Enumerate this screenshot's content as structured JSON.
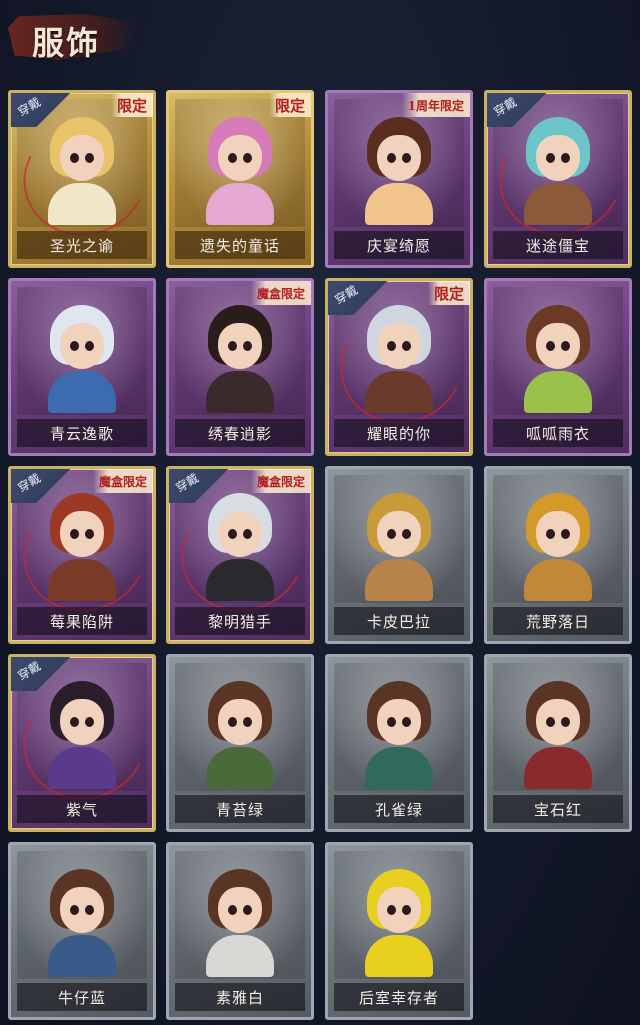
{
  "header": {
    "title": "服饰"
  },
  "worn_label": "穿戴",
  "cards": [
    {
      "name": "圣光之谕",
      "rarity": "gold",
      "tag": "限定",
      "worn": true,
      "hair": "#e9c36a",
      "body": "#f2e6c8"
    },
    {
      "name": "遗失的童话",
      "rarity": "gold",
      "tag": "限定",
      "worn": false,
      "hair": "#d77ab8",
      "body": "#e4a8d2"
    },
    {
      "name": "庆宴绮愿",
      "rarity": "purple",
      "tag": "1周年限定",
      "worn": false,
      "hair": "#5a2e1f",
      "body": "#f0c48a"
    },
    {
      "name": "迷途僵宝",
      "rarity": "purple",
      "tag": "",
      "worn": true,
      "hair": "#6cc6c8",
      "body": "#8a5a3a"
    },
    {
      "name": "青云逸歌",
      "rarity": "purple",
      "tag": "",
      "worn": false,
      "hair": "#dfe6ef",
      "body": "#3c6bb0"
    },
    {
      "name": "绣春逍影",
      "rarity": "purple",
      "tag": "魔盒限定",
      "worn": false,
      "hair": "#2a1c18",
      "body": "#3a2a2a"
    },
    {
      "name": "耀眼的你",
      "rarity": "purple",
      "tag": "限定",
      "worn": true,
      "hair": "#cfd6e0",
      "body": "#6a3a2a"
    },
    {
      "name": "呱呱雨衣",
      "rarity": "purple",
      "tag": "",
      "worn": false,
      "hair": "#6b3a24",
      "body": "#9ac24a"
    },
    {
      "name": "莓果陷阱",
      "rarity": "purple",
      "tag": "魔盒限定",
      "worn": true,
      "hair": "#9a3a24",
      "body": "#7a3a28"
    },
    {
      "name": "黎明猎手",
      "rarity": "purple",
      "tag": "魔盒限定",
      "worn": true,
      "hair": "#d8dde4",
      "body": "#2a2a30"
    },
    {
      "name": "卡皮巴拉",
      "rarity": "grey",
      "tag": "",
      "worn": false,
      "hair": "#c99a3a",
      "body": "#b8834a"
    },
    {
      "name": "荒野落日",
      "rarity": "grey",
      "tag": "",
      "worn": false,
      "hair": "#d39a2a",
      "body": "#c08838"
    },
    {
      "name": "紫气",
      "rarity": "purple",
      "tag": "",
      "worn": true,
      "hair": "#2a1e2a",
      "body": "#5a3a8a"
    },
    {
      "name": "青苔绿",
      "rarity": "grey",
      "tag": "",
      "worn": false,
      "hair": "#5a3424",
      "body": "#4a6a3a"
    },
    {
      "name": "孔雀绿",
      "rarity": "grey",
      "tag": "",
      "worn": false,
      "hair": "#5a3424",
      "body": "#2f6a5a"
    },
    {
      "name": "宝石红",
      "rarity": "grey",
      "tag": "",
      "worn": false,
      "hair": "#5a3424",
      "body": "#8a2a2a"
    },
    {
      "name": "牛仔蓝",
      "rarity": "grey",
      "tag": "",
      "worn": false,
      "hair": "#5a3424",
      "body": "#3a5a8a"
    },
    {
      "name": "素雅白",
      "rarity": "grey",
      "tag": "",
      "worn": false,
      "hair": "#5a3424",
      "body": "#d8d8d4"
    },
    {
      "name": "后室幸存者",
      "rarity": "grey",
      "tag": "",
      "worn": false,
      "hair": "#e8d020",
      "body": "#e8d020"
    }
  ]
}
